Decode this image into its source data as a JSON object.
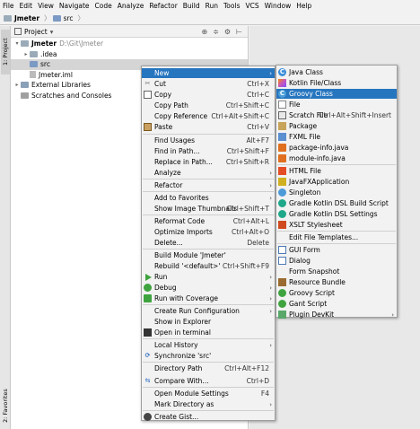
{
  "menubar": [
    "File",
    "Edit",
    "View",
    "Navigate",
    "Code",
    "Analyze",
    "Refactor",
    "Build",
    "Run",
    "Tools",
    "VCS",
    "Window",
    "Help"
  ],
  "breadcrumb": {
    "project": "Jmeter",
    "folder": "src"
  },
  "left_tabs": {
    "project": "1: Project",
    "favorites": "2: Favorites"
  },
  "panel": {
    "title": "Project",
    "dropdown": "▾",
    "tools": [
      "⊕",
      "≑",
      "⚙",
      "⊢"
    ]
  },
  "tree": [
    {
      "label": "Jmeter",
      "extra": "D:\\Git\\Jmeter",
      "arrow": "▾"
    },
    {
      "label": ".idea",
      "arrow": "▸"
    },
    {
      "label": "src",
      "arrow": ""
    },
    {
      "label": "Jmeter.iml",
      "arrow": ""
    },
    {
      "label": "External Libraries",
      "arrow": "▸"
    },
    {
      "label": "Scratches and Consoles",
      "arrow": ""
    }
  ],
  "context_menu": [
    {
      "label": "New",
      "shortcut": "",
      "submenu": true,
      "icon": "none"
    },
    {
      "label": "Cut",
      "shortcut": "Ctrl+X",
      "icon": "cut-icon"
    },
    {
      "label": "Copy",
      "shortcut": "Ctrl+C",
      "icon": "copy-icon"
    },
    {
      "label": "Copy Path",
      "shortcut": "Ctrl+Shift+C",
      "icon": "none"
    },
    {
      "label": "Copy Reference",
      "shortcut": "Ctrl+Alt+Shift+C",
      "icon": "none"
    },
    {
      "label": "Paste",
      "shortcut": "Ctrl+V",
      "icon": "paste-icon"
    },
    {
      "label": "Find Usages",
      "shortcut": "Alt+F7",
      "icon": "none"
    },
    {
      "label": "Find in Path...",
      "shortcut": "Ctrl+Shift+F",
      "icon": "none"
    },
    {
      "label": "Replace in Path...",
      "shortcut": "Ctrl+Shift+R",
      "icon": "none"
    },
    {
      "label": "Analyze",
      "shortcut": "",
      "submenu": true,
      "icon": "none"
    },
    {
      "label": "Refactor",
      "shortcut": "",
      "submenu": true,
      "icon": "none"
    },
    {
      "label": "Add to Favorites",
      "shortcut": "",
      "submenu": true,
      "icon": "none"
    },
    {
      "label": "Show Image Thumbnails",
      "shortcut": "Ctrl+Shift+T",
      "icon": "none"
    },
    {
      "label": "Reformat Code",
      "shortcut": "Ctrl+Alt+L",
      "icon": "none"
    },
    {
      "label": "Optimize Imports",
      "shortcut": "Ctrl+Alt+O",
      "icon": "none"
    },
    {
      "label": "Delete...",
      "shortcut": "Delete",
      "icon": "none"
    },
    {
      "label": "Build Module 'Jmeter'",
      "shortcut": "",
      "icon": "none"
    },
    {
      "label": "Rebuild '<default>'",
      "shortcut": "Ctrl+Shift+F9",
      "icon": "none"
    },
    {
      "label": "Run",
      "shortcut": "",
      "submenu": true,
      "icon": "run-icon"
    },
    {
      "label": "Debug",
      "shortcut": "",
      "submenu": true,
      "icon": "debug-icon"
    },
    {
      "label": "Run with Coverage",
      "shortcut": "",
      "submenu": true,
      "icon": "coverage-icon"
    },
    {
      "label": "Create Run Configuration",
      "shortcut": "",
      "submenu": true,
      "icon": "none"
    },
    {
      "label": "Show in Explorer",
      "shortcut": "",
      "icon": "none"
    },
    {
      "label": "Open in terminal",
      "shortcut": "",
      "icon": "terminal-icon"
    },
    {
      "label": "Local History",
      "shortcut": "",
      "submenu": true,
      "icon": "none"
    },
    {
      "label": "Synchronize 'src'",
      "shortcut": "",
      "icon": "sync-icon"
    },
    {
      "label": "Directory Path",
      "shortcut": "Ctrl+Alt+F12",
      "icon": "none"
    },
    {
      "label": "Compare With...",
      "shortcut": "Ctrl+D",
      "icon": "compare-icon"
    },
    {
      "label": "Open Module Settings",
      "shortcut": "F4",
      "icon": "none"
    },
    {
      "label": "Mark Directory as",
      "shortcut": "",
      "submenu": true,
      "icon": "none"
    },
    {
      "label": "Create Gist...",
      "shortcut": "",
      "icon": "git-icon"
    }
  ],
  "new_submenu": [
    {
      "label": "Java Class",
      "shortcut": "",
      "icon": "java-class-icon"
    },
    {
      "label": "Kotlin File/Class",
      "shortcut": "",
      "icon": "kotlin-icon"
    },
    {
      "label": "Groovy Class",
      "shortcut": "",
      "icon": "groovy-class-icon"
    },
    {
      "label": "File",
      "shortcut": "",
      "icon": "file-icon"
    },
    {
      "label": "Scratch File",
      "shortcut": "Ctrl+Alt+Shift+Insert",
      "icon": "scratch-file-icon"
    },
    {
      "label": "Package",
      "shortcut": "",
      "icon": "package-icon"
    },
    {
      "label": "FXML File",
      "shortcut": "",
      "icon": "fxml-icon"
    },
    {
      "label": "package-info.java",
      "shortcut": "",
      "icon": "java-file-icon"
    },
    {
      "label": "module-info.java",
      "shortcut": "",
      "icon": "java-file-icon"
    },
    {
      "label": "HTML File",
      "shortcut": "",
      "icon": "html-icon"
    },
    {
      "label": "JavaFXApplication",
      "shortcut": "",
      "icon": "javafx-icon"
    },
    {
      "label": "Singleton",
      "shortcut": "",
      "icon": "singleton-icon"
    },
    {
      "label": "Gradle Kotlin DSL Build Script",
      "shortcut": "",
      "icon": "gradle-icon"
    },
    {
      "label": "Gradle Kotlin DSL Settings",
      "shortcut": "",
      "icon": "gradle-icon"
    },
    {
      "label": "XSLT Stylesheet",
      "shortcut": "",
      "icon": "xslt-icon"
    },
    {
      "label": "Edit File Templates...",
      "shortcut": "",
      "icon": "none"
    },
    {
      "label": "GUI Form",
      "shortcut": "",
      "icon": "gui-form-icon"
    },
    {
      "label": "Dialog",
      "shortcut": "",
      "icon": "dialog-icon"
    },
    {
      "label": "Form Snapshot",
      "shortcut": "",
      "icon": "none"
    },
    {
      "label": "Resource Bundle",
      "shortcut": "",
      "icon": "resource-bundle-icon"
    },
    {
      "label": "Groovy Script",
      "shortcut": "",
      "icon": "groovy-script-icon"
    },
    {
      "label": "Gant Script",
      "shortcut": "",
      "icon": "gant-script-icon"
    },
    {
      "label": "Plugin DevKit",
      "shortcut": "",
      "submenu": true,
      "icon": "plugin-icon"
    }
  ]
}
